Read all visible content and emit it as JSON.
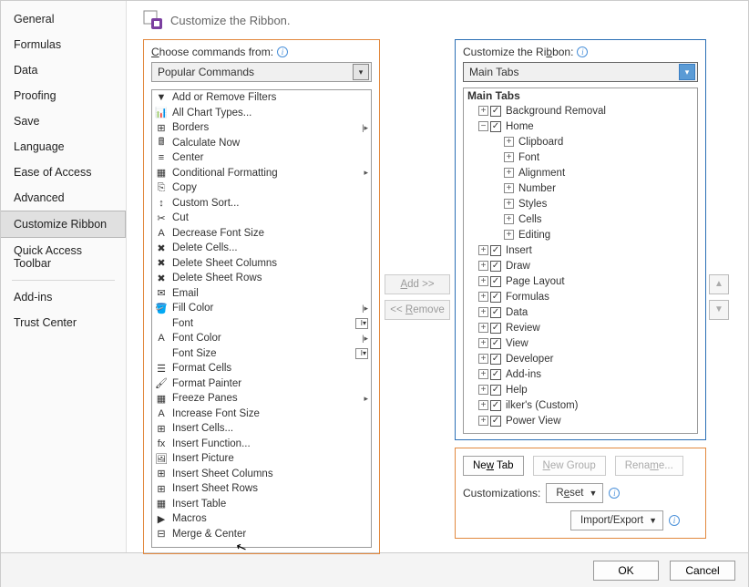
{
  "heading": "Customize the Ribbon.",
  "sidebar": {
    "items": [
      "General",
      "Formulas",
      "Data",
      "Proofing",
      "Save",
      "Language",
      "Ease of Access",
      "Advanced",
      "Customize Ribbon",
      "Quick Access Toolbar",
      "Add-ins",
      "Trust Center"
    ],
    "active_index": 8
  },
  "left_panel": {
    "label": "Choose commands from:",
    "dropdown": "Popular Commands",
    "commands": [
      {
        "label": "Add or Remove Filters",
        "icon": "▼"
      },
      {
        "label": "All Chart Types...",
        "icon": "📊"
      },
      {
        "label": "Borders",
        "icon": "⊞",
        "arrow": true,
        "split": true
      },
      {
        "label": "Calculate Now",
        "icon": "🖩"
      },
      {
        "label": "Center",
        "icon": "≡"
      },
      {
        "label": "Conditional Formatting",
        "icon": "▦",
        "arrow": true
      },
      {
        "label": "Copy",
        "icon": "⎘"
      },
      {
        "label": "Custom Sort...",
        "icon": "↕"
      },
      {
        "label": "Cut",
        "icon": "✂"
      },
      {
        "label": "Decrease Font Size",
        "icon": "A"
      },
      {
        "label": "Delete Cells...",
        "icon": "✖"
      },
      {
        "label": "Delete Sheet Columns",
        "icon": "✖"
      },
      {
        "label": "Delete Sheet Rows",
        "icon": "✖"
      },
      {
        "label": "Email",
        "icon": "✉"
      },
      {
        "label": "Fill Color",
        "icon": "🪣",
        "arrow": true,
        "split": true
      },
      {
        "label": "Font",
        "icon": "",
        "box": true
      },
      {
        "label": "Font Color",
        "icon": "A",
        "arrow": true,
        "split": true
      },
      {
        "label": "Font Size",
        "icon": "",
        "box": true
      },
      {
        "label": "Format Cells",
        "icon": "☰"
      },
      {
        "label": "Format Painter",
        "icon": "🖌"
      },
      {
        "label": "Freeze Panes",
        "icon": "▦",
        "arrow": true
      },
      {
        "label": "Increase Font Size",
        "icon": "A"
      },
      {
        "label": "Insert Cells...",
        "icon": "⊞"
      },
      {
        "label": "Insert Function...",
        "icon": "fx"
      },
      {
        "label": "Insert Picture",
        "icon": "🖼"
      },
      {
        "label": "Insert Sheet Columns",
        "icon": "⊞"
      },
      {
        "label": "Insert Sheet Rows",
        "icon": "⊞"
      },
      {
        "label": "Insert Table",
        "icon": "▦"
      },
      {
        "label": "Macros",
        "icon": "▶"
      },
      {
        "label": "Merge & Center",
        "icon": "⊟"
      }
    ]
  },
  "mid": {
    "add": "Add >>",
    "remove": "<< Remove"
  },
  "right_panel": {
    "label": "Customize the Ribbon:",
    "dropdown": "Main Tabs",
    "tree_header": "Main Tabs",
    "tabs": [
      {
        "label": "Background Removal",
        "exp": "+",
        "ind": 1
      },
      {
        "label": "Home",
        "exp": "−",
        "ind": 1
      },
      {
        "label": "Clipboard",
        "exp": "+",
        "ind": 2,
        "nochk": true
      },
      {
        "label": "Font",
        "exp": "+",
        "ind": 2,
        "nochk": true
      },
      {
        "label": "Alignment",
        "exp": "+",
        "ind": 2,
        "nochk": true
      },
      {
        "label": "Number",
        "exp": "+",
        "ind": 2,
        "nochk": true
      },
      {
        "label": "Styles",
        "exp": "+",
        "ind": 2,
        "nochk": true
      },
      {
        "label": "Cells",
        "exp": "+",
        "ind": 2,
        "nochk": true
      },
      {
        "label": "Editing",
        "exp": "+",
        "ind": 2,
        "nochk": true
      },
      {
        "label": "Insert",
        "exp": "+",
        "ind": 1
      },
      {
        "label": "Draw",
        "exp": "+",
        "ind": 1
      },
      {
        "label": "Page Layout",
        "exp": "+",
        "ind": 1
      },
      {
        "label": "Formulas",
        "exp": "+",
        "ind": 1
      },
      {
        "label": "Data",
        "exp": "+",
        "ind": 1
      },
      {
        "label": "Review",
        "exp": "+",
        "ind": 1
      },
      {
        "label": "View",
        "exp": "+",
        "ind": 1
      },
      {
        "label": "Developer",
        "exp": "+",
        "ind": 1
      },
      {
        "label": "Add-ins",
        "exp": "+",
        "ind": 1
      },
      {
        "label": "Help",
        "exp": "+",
        "ind": 1
      },
      {
        "label": "ilker's (Custom)",
        "exp": "+",
        "ind": 1
      },
      {
        "label": "Power View",
        "exp": "+",
        "ind": 1
      }
    ]
  },
  "bottom": {
    "new_tab": "New Tab",
    "new_group": "New Group",
    "rename": "Rename...",
    "cust_label": "Customizations:",
    "reset": "Reset",
    "import_export": "Import/Export"
  },
  "footer": {
    "ok": "OK",
    "cancel": "Cancel"
  }
}
